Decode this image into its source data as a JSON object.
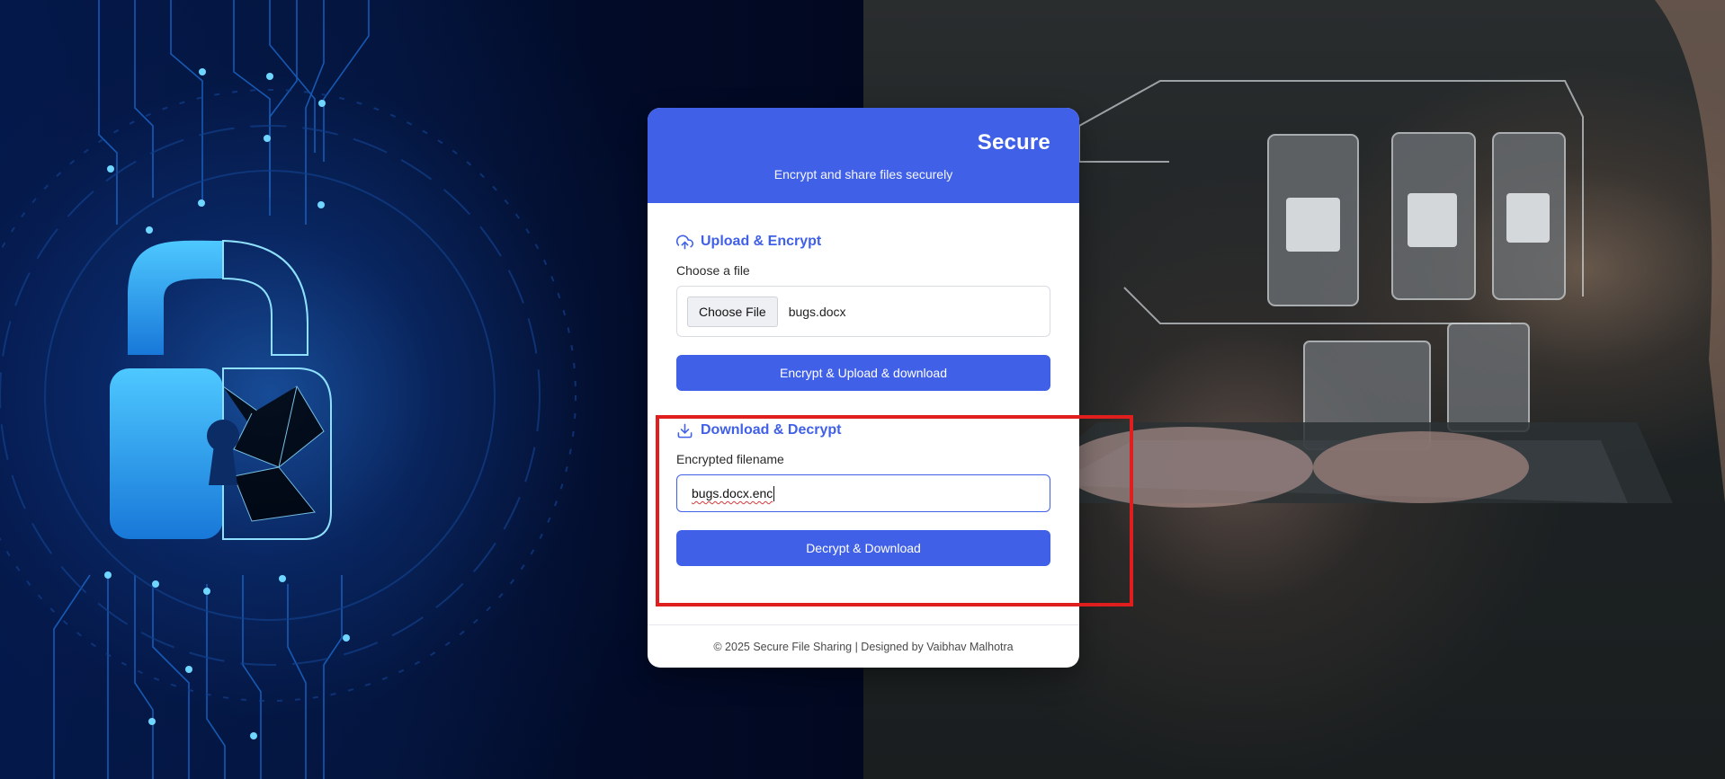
{
  "app": {
    "title": "Secure",
    "subtitle": "Encrypt and share files securely"
  },
  "upload": {
    "heading": "Upload & Encrypt",
    "icon": "upload-cloud-icon",
    "file_label": "Choose a file",
    "choose_button": "Choose File",
    "selected_file": "bugs.docx",
    "submit_label": "Encrypt & Upload & download"
  },
  "download": {
    "heading": "Download & Decrypt",
    "icon": "download-icon",
    "filename_label": "Encrypted filename",
    "filename_value": "bugs.docx.enc",
    "submit_label": "Decrypt & Download"
  },
  "footer": {
    "text": "© 2025 Secure File Sharing | Designed by Vaibhav Malhotra"
  },
  "colors": {
    "accent": "#4060e8",
    "highlight": "#e01e1e",
    "background_left": "#03143c",
    "background_right": "#1d2224"
  }
}
